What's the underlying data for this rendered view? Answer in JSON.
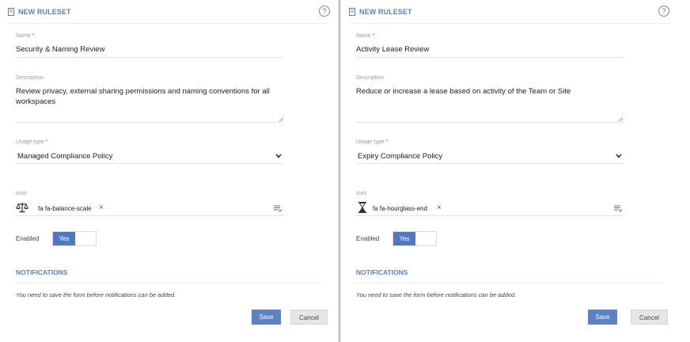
{
  "panels": [
    {
      "header_title": "NEW RULESET",
      "help": "?",
      "name_label": "Name",
      "required_mark": "*",
      "name_value": "Security & Naming Review",
      "description_label": "Description",
      "description_value": "Review privacy, external sharing permissions and naming conventions for all workspaces",
      "usage_label": "Usage type",
      "usage_value": "Managed Compliance Policy",
      "icon_label": "Icon",
      "icon_glyph": "balance-scale-icon",
      "icon_value": "fa fa-balance-scale",
      "enabled_label": "Enabled",
      "enabled_toggle": "Yes",
      "notifications_title": "NOTIFICATIONS",
      "notifications_note": "You need to save the form before notifications can be added.",
      "save_label": "Save",
      "cancel_label": "Cancel"
    },
    {
      "header_title": "NEW RULESET",
      "help": "?",
      "name_label": "Name",
      "required_mark": "*",
      "name_value": "Activity Lease Review",
      "description_label": "Description",
      "description_value": "Reduce or increase a lease based on activity of the Team or Site",
      "usage_label": "Usage type",
      "usage_value": "Expiry Compliance Policy",
      "icon_label": "Icon",
      "icon_glyph": "hourglass-end-icon",
      "icon_value": "fa fa-hourglass-end",
      "enabled_label": "Enabled",
      "enabled_toggle": "Yes",
      "notifications_title": "NOTIFICATIONS",
      "notifications_note": "You need to save the form before notifications can be added.",
      "save_label": "Save",
      "cancel_label": "Cancel"
    }
  ],
  "colors": {
    "accent": "#5b7fbd",
    "button_primary": "#5b82c8",
    "toggle_on": "#4f78c4",
    "required": "#d9534f"
  }
}
